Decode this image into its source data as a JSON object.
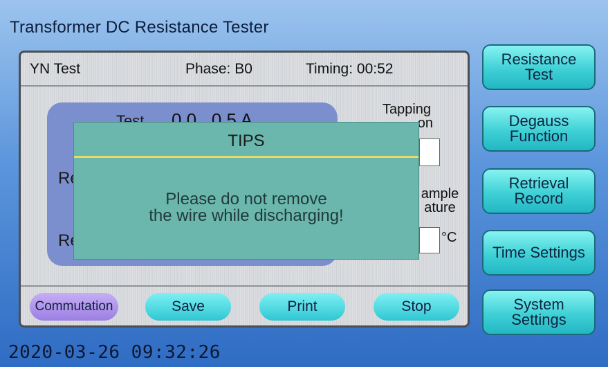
{
  "app_title": "Transformer DC Resistance Tester",
  "header": {
    "mode": "YN Test",
    "phase": "Phase: B0",
    "timing": "Timing: 00:52"
  },
  "measurement": {
    "test_label": "Test",
    "test_value": "0 0 . 0 5   A",
    "row1_label": "Re",
    "row2_label": "Re"
  },
  "side": {
    "tapping_label_line1": "Tapping",
    "tapping_label_line2": "on",
    "temperature_label_line1": "ample",
    "temperature_label_line2": "ature",
    "temperature_unit": "°C"
  },
  "buttons": {
    "commutation": "Commutation",
    "save": "Save",
    "print": "Print",
    "stop": "Stop"
  },
  "nav": {
    "resistance_test": "Resistance Test",
    "degauss_function": "Degauss Function",
    "retrieval_record": "Retrieval Record",
    "time_settings": "Time Settings",
    "system_settings": "System Settings"
  },
  "datetime": "2020-03-26 09:32:26",
  "dialog": {
    "title": "TIPS",
    "message_line1": "Please do not remove",
    "message_line2": "the wire while discharging!"
  }
}
